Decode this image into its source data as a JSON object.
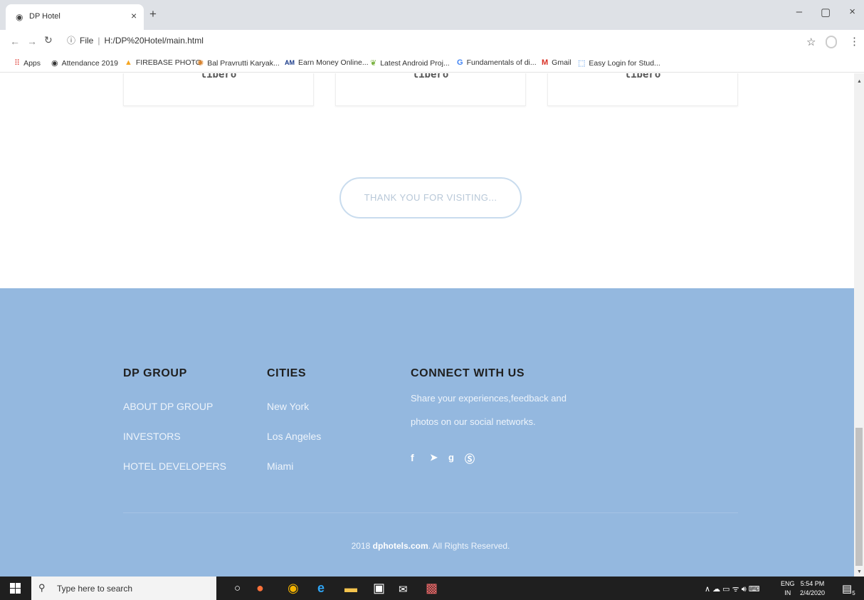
{
  "browser": {
    "tab_title": "DP Hotel",
    "tab_close": "×",
    "new_tab": "+",
    "url_prefix": "File",
    "url": "H:/DP%20Hotel/main.html",
    "window_controls": [
      "–",
      "▢",
      "×"
    ]
  },
  "bookmarks": [
    {
      "label": "Apps",
      "icon": "apps-grid-icon",
      "color": "#e0443c"
    },
    {
      "label": "Attendance 2019",
      "icon": "globe-icon",
      "color": "#555555"
    },
    {
      "label": "FIREBASE PHOTO",
      "icon": "firebase-icon",
      "color": "#f5a623"
    },
    {
      "label": "Bal Pravrutti Karyak...",
      "icon": "emblem-icon",
      "color": "#d9822b"
    },
    {
      "label": "Earn Money Online...",
      "icon": "am-logo-icon",
      "color": "#1a3b8a"
    },
    {
      "label": "Latest Android Proj...",
      "icon": "leaf-icon",
      "color": "#7cb342"
    },
    {
      "label": "Fundamentals of di...",
      "icon": "google-icon",
      "color": "#4285f4"
    },
    {
      "label": "Gmail",
      "icon": "gmail-icon",
      "color": "#d93025"
    },
    {
      "label": "Easy Login for Stud...",
      "icon": "login-icon",
      "color": "#2a7de1"
    }
  ],
  "cards": [
    "libero",
    "libero",
    "libero"
  ],
  "thanks_label": "THANK YOU FOR VISITING...",
  "footer": {
    "group_heading": "DP GROUP",
    "group_links": [
      "ABOUT DP GROUP",
      "INVESTORS",
      "HOTEL DEVELOPERS"
    ],
    "cities_heading": "CITIES",
    "cities": [
      "New York",
      "Los Angeles",
      "Miami"
    ],
    "connect_heading": "CONNECT WITH US",
    "connect_lines": [
      "Share your experiences,feedback and",
      "photos on our social networks."
    ],
    "social_icons": [
      "facebook-icon",
      "twitter-icon",
      "google-plus-icon",
      "skype-icon"
    ],
    "copyright_year": "2018",
    "copyright_site": "dphotels.com",
    "copyright_rest": ". All Rights Reserved."
  },
  "taskbar": {
    "search_placeholder": "Type here to search",
    "lang_top": "ENG",
    "lang_bottom": "IN",
    "time": "5:54 PM",
    "date": "2/4/2020",
    "notification_count": "5"
  }
}
